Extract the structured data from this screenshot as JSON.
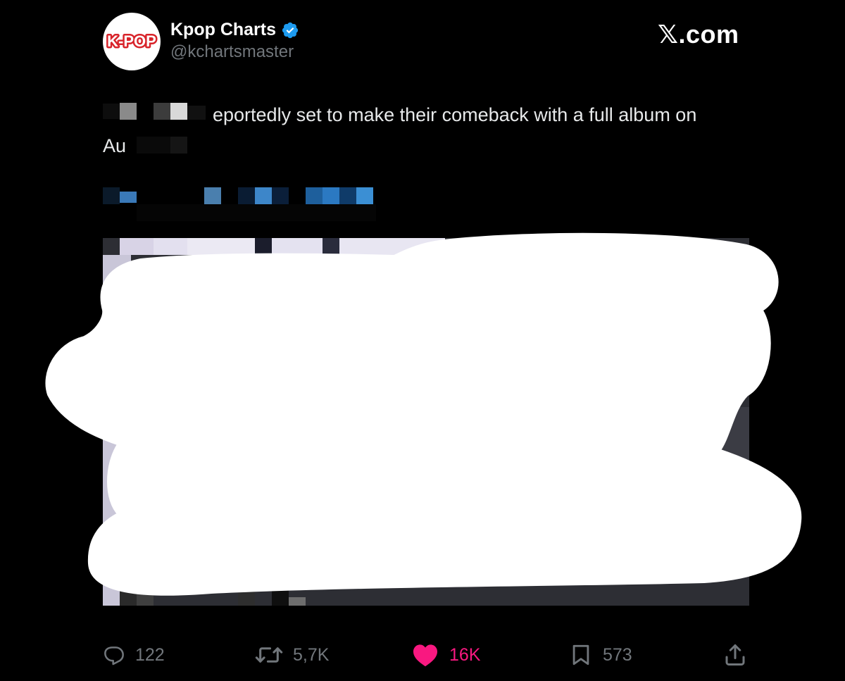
{
  "header": {
    "avatar_logo_text": "K-POP",
    "display_name": "Kpop Charts",
    "handle": "@kchartsmaster",
    "brand": "𝕏.com",
    "verified_icon": "verified-badge-icon"
  },
  "tweet": {
    "line_1_visible": "eportedly set to make their comeback with a full album on",
    "line_2_visible": "Au"
  },
  "actions": {
    "reply": {
      "icon": "reply-icon",
      "count": "122"
    },
    "retweet": {
      "icon": "retweet-icon",
      "count": "5,7K"
    },
    "like": {
      "icon": "heart-icon",
      "count": "16K",
      "liked": true
    },
    "bookmark": {
      "icon": "bookmark-icon",
      "count": "573"
    },
    "share": {
      "icon": "share-icon"
    }
  },
  "colors": {
    "background": "#000000",
    "text": "#e7e9ea",
    "muted": "#71767b",
    "verified": "#1d9bf0",
    "like": "#f91880",
    "logo_red": "#d8232a",
    "redaction": "#ffffff"
  }
}
